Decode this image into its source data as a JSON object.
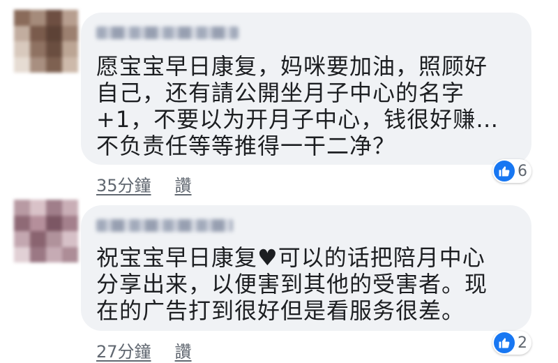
{
  "colors": {
    "accent": "#1877f2",
    "bubble": "#f0f2f5",
    "text": "#1c1e21",
    "meta": "#606770"
  },
  "comments": [
    {
      "lines": [
        "愿宝宝早日康复，妈咪要加油，照顾好",
        "自己，还有請公開坐月子中心的名字",
        "+1，不要以为开月子中心，钱很好赚…",
        "不负责任等等推得一干二净？"
      ],
      "time": "35分鐘",
      "like_label": "讚",
      "reaction_icon": "like-thumbs-up-icon",
      "reaction_count": "6"
    },
    {
      "lines": [
        "祝宝宝早日康复♥可以的话把陪月中心",
        "分享出来，以便害到其他的受害者。现",
        "在的广告打到很好但是看服务很差。"
      ],
      "time": "27分鐘",
      "like_label": "讚",
      "reaction_icon": "like-thumbs-up-icon",
      "reaction_count": "2"
    }
  ]
}
